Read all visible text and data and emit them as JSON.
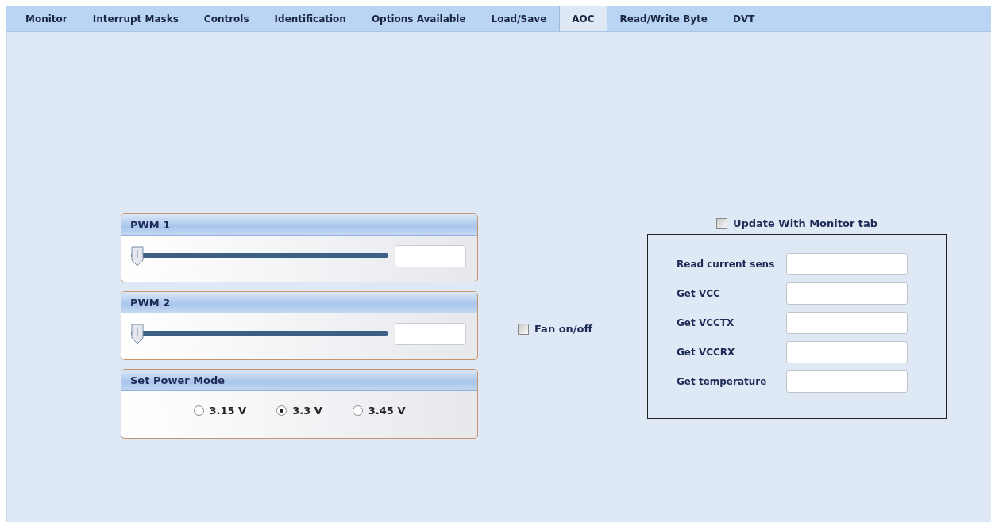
{
  "tabs": [
    {
      "label": "Monitor",
      "selected": false
    },
    {
      "label": "Interrupt Masks",
      "selected": false
    },
    {
      "label": "Controls",
      "selected": false
    },
    {
      "label": "Identification",
      "selected": false
    },
    {
      "label": "Options Available",
      "selected": false
    },
    {
      "label": "Load/Save",
      "selected": false
    },
    {
      "label": "AOC",
      "selected": true
    },
    {
      "label": "Read/Write Byte",
      "selected": false
    },
    {
      "label": "DVT",
      "selected": false
    }
  ],
  "pwm_panels": [
    {
      "title": "PWM 1",
      "level": 0
    },
    {
      "title": "PWM 2",
      "level": 0
    }
  ],
  "power_mode": {
    "title": "Set Power Mode",
    "options": [
      {
        "label": "3.15 V",
        "selected": false
      },
      {
        "label": "3.3 V",
        "selected": true
      },
      {
        "label": "3.45 V",
        "selected": false
      }
    ]
  },
  "fan": {
    "label": "Fan on/off",
    "checked": false
  },
  "update_with_monitor": {
    "label": "Update With Monitor tab",
    "checked": false
  },
  "readings": [
    {
      "label": "Read current sens"
    },
    {
      "label": "Get VCC"
    },
    {
      "label": "Get VCCTX"
    },
    {
      "label": "Get VCCRX"
    },
    {
      "label": "Get temperature"
    }
  ]
}
